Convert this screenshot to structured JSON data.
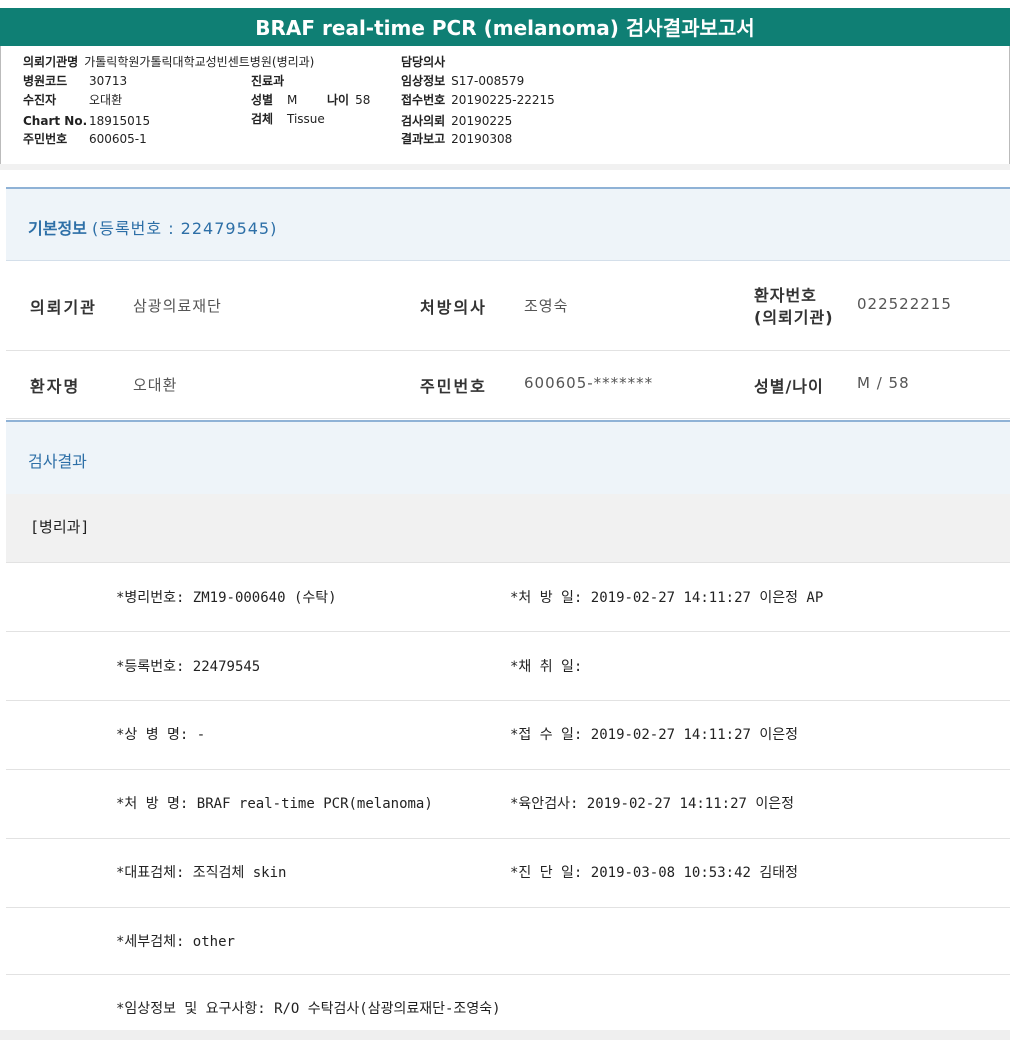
{
  "title": "BRAF real-time PCR (melanoma) 검사결과보고서",
  "header": {
    "col1": [
      {
        "key": "의뢰기관명",
        "value": "가톨릭학원가톨릭대학교성빈센트병원(병리과)"
      },
      {
        "key": "병원코드",
        "value": "30713"
      },
      {
        "key": "수진자",
        "value": "오대환"
      },
      {
        "key": "Chart No.",
        "value": "18915015"
      },
      {
        "key": "주민번호",
        "value": "600605-1"
      }
    ],
    "col2": [
      {
        "key": "진료과",
        "value": ""
      },
      {
        "key": "성별",
        "value": "M"
      },
      {
        "key": "나이",
        "value": "58"
      },
      {
        "key": "검체",
        "value": "Tissue"
      }
    ],
    "col3": [
      {
        "key": "담당의사",
        "value": ""
      },
      {
        "key": "임상정보",
        "value": "S17-008579"
      },
      {
        "key": "접수번호",
        "value": "20190225-22215"
      },
      {
        "key": "검사의뢰",
        "value": "20190225"
      },
      {
        "key": "결과보고",
        "value": "20190308"
      }
    ]
  },
  "basic": {
    "heading": "기본정보",
    "reg_label": "(등록번호 : 22479545)",
    "row1": {
      "inst_label": "의뢰기관",
      "inst_value": "삼광의료재단",
      "doctor_label": "처방의사",
      "doctor_value": "조영숙",
      "pno_label1": "환자번호",
      "pno_label2": "(의뢰기관)",
      "pno_value": "022522215"
    },
    "row2": {
      "name_label": "환자명",
      "name_value": "오대환",
      "rrn_label": "주민번호",
      "rrn_value": "600605-*******",
      "sexage_label": "성별/나이",
      "sexage_value": "M / 58"
    }
  },
  "result": {
    "heading": "검사결과",
    "dept": "[병리과]",
    "lines": [
      {
        "left": "*병리번호: ZM19-000640 (수탁)",
        "right": "*처 방 일: 2019-02-27 14:11:27  이은정 AP"
      },
      {
        "left": "*등록번호: 22479545",
        "right": "*채 취 일:"
      },
      {
        "left": "*상 병 명: -",
        "right": "*접 수 일: 2019-02-27 14:11:27  이은정"
      },
      {
        "left": "*처 방 명: BRAF real-time PCR(melanoma)",
        "right": "*육안검사: 2019-02-27 14:11:27  이은정"
      },
      {
        "left": "*대표검체: 조직검체 skin",
        "right": "*진 단 일: 2019-03-08 10:53:42  김태정"
      },
      {
        "left": "*세부검체: other",
        "right": ""
      },
      {
        "left": "*임상정보 및 요구사항: R/O 수탁검사(삼광의료재단-조영숙)",
        "right": ""
      }
    ]
  }
}
